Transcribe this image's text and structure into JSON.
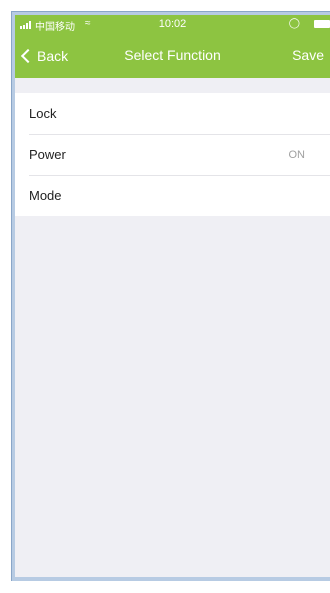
{
  "status_bar": {
    "carrier": "中国移动",
    "wifi_icon": "wifi-icon",
    "time": "10:02",
    "alarm_icon": "alarm-icon",
    "battery_icon": "battery-icon"
  },
  "nav": {
    "back_label": "Back",
    "title": "Select Function",
    "save_label": "Save"
  },
  "functions": [
    {
      "label": "Lock",
      "value": ""
    },
    {
      "label": "Power",
      "value": "ON"
    },
    {
      "label": "Mode",
      "value": ""
    }
  ],
  "colors": {
    "header_bg": "#8dc441",
    "page_bg": "#efeff4",
    "frame": "#b7cbe3"
  }
}
